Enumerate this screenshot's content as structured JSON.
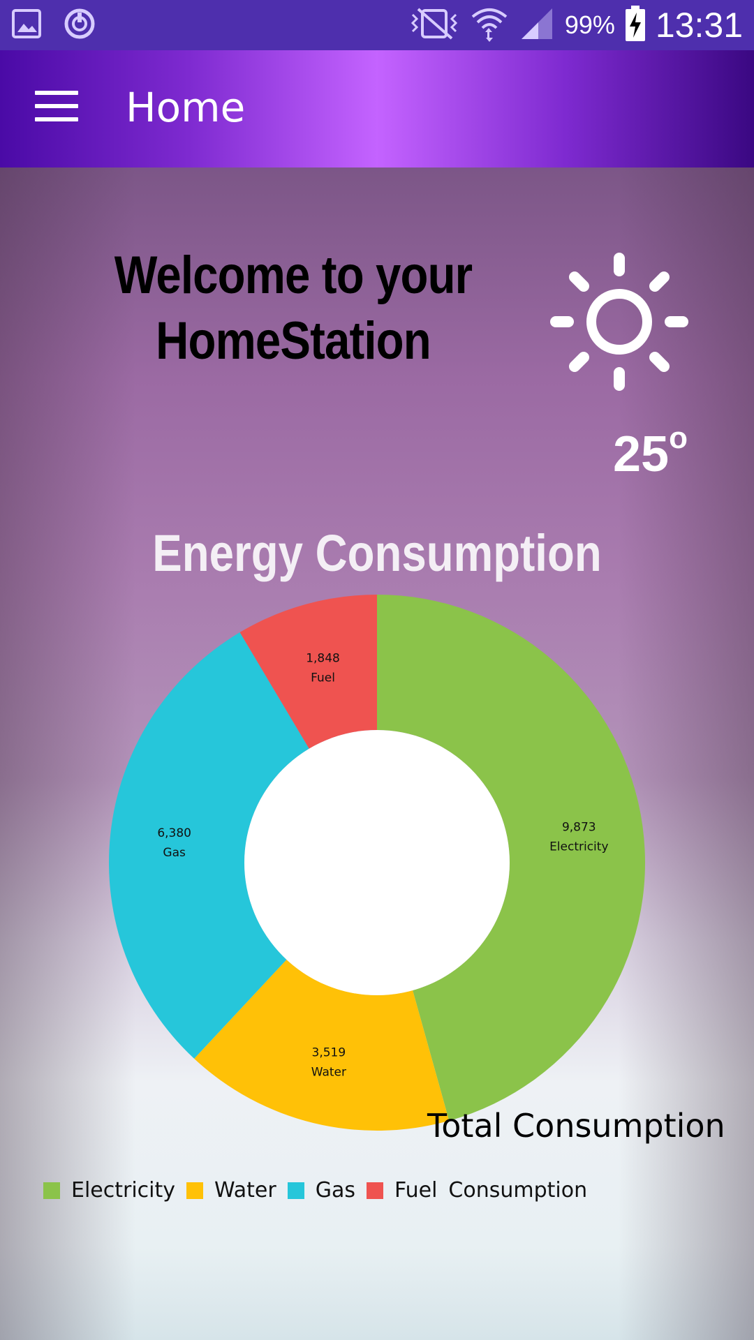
{
  "status_bar": {
    "battery": "99%",
    "time": "13:31",
    "icons": [
      "gallery-icon",
      "sync-icon",
      "vibrate-icon",
      "wifi-icon",
      "signal-icon",
      "battery-charging-icon"
    ]
  },
  "app_bar": {
    "title": "Home",
    "menu_icon": "hamburger-menu-icon"
  },
  "welcome": {
    "line1": "Welcome to your",
    "line2": "HomeStation"
  },
  "weather": {
    "icon": "sun-icon",
    "temperature": "25",
    "degree_symbol": "o"
  },
  "chart_data": {
    "type": "pie",
    "style": "donut",
    "title": "Energy Consumption",
    "center_label": "Total Consumption",
    "legend_title": "Consumption",
    "legend_position": "bottom-left",
    "series": [
      {
        "name": "Electricity",
        "value": 9873,
        "label": "9,873",
        "color": "#8bc34a"
      },
      {
        "name": "Water",
        "value": 3519,
        "label": "3,519",
        "color": "#ffc107"
      },
      {
        "name": "Gas",
        "value": 6380,
        "label": "6,380",
        "color": "#26c6da"
      },
      {
        "name": "Fuel",
        "value": 1848,
        "label": "1,848",
        "color": "#ef5350"
      }
    ]
  }
}
